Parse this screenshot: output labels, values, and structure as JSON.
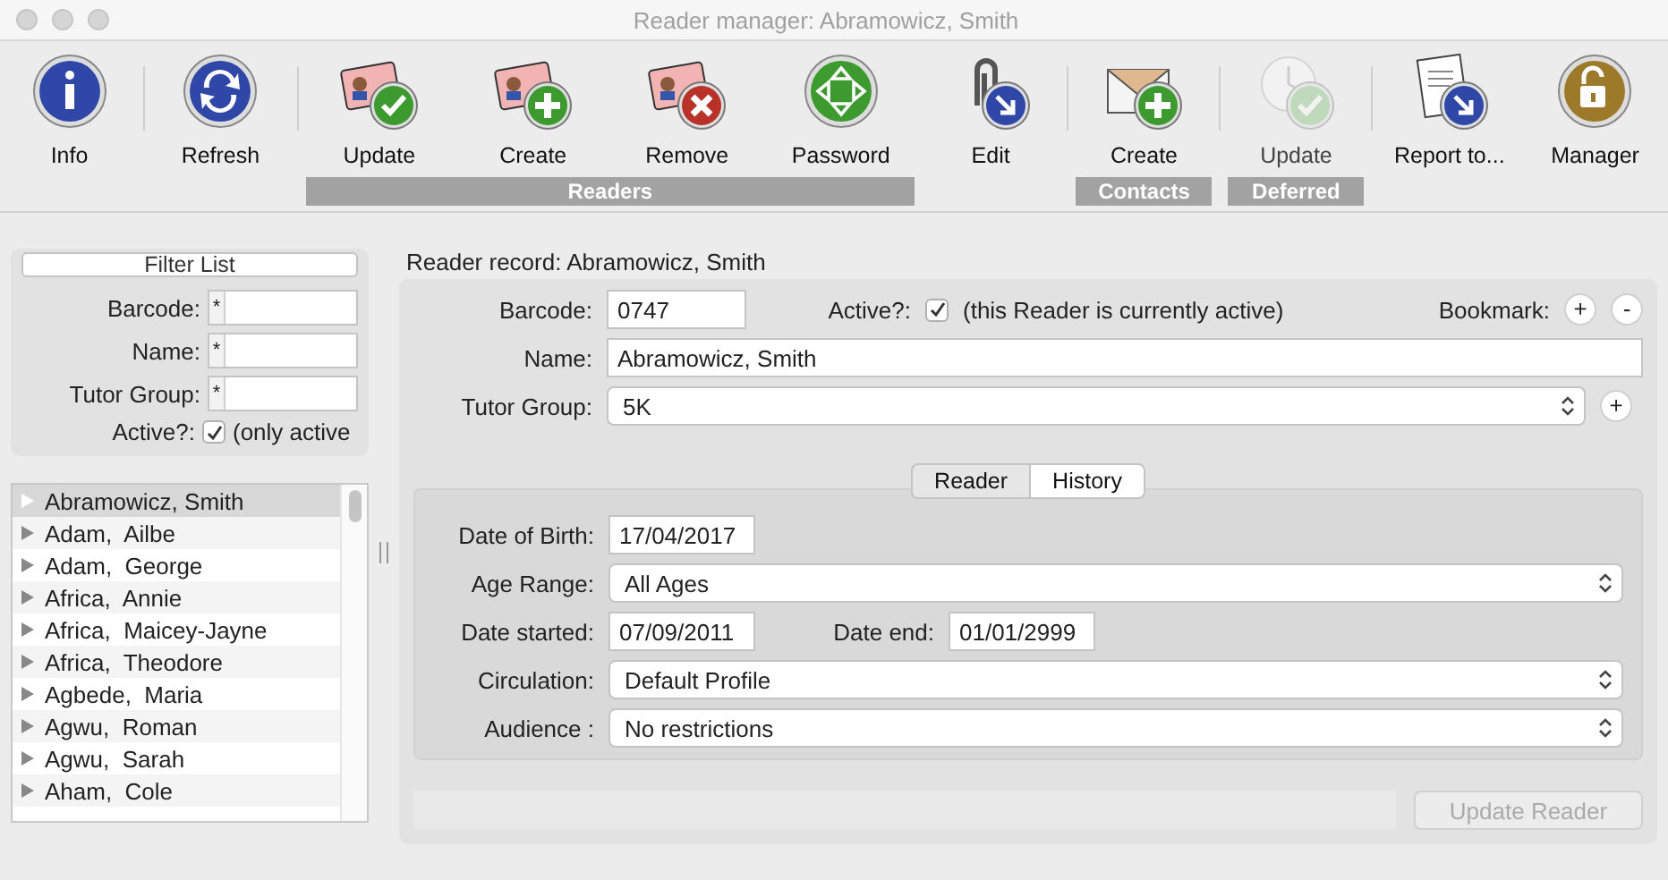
{
  "window": {
    "title": "Reader manager: Abramowicz, Smith"
  },
  "toolbar": [
    {
      "kind": "item",
      "label": "Info",
      "disabled": false
    },
    {
      "kind": "separator"
    },
    {
      "kind": "item",
      "label": "Refresh",
      "disabled": false
    },
    {
      "kind": "separator"
    },
    {
      "kind": "group",
      "label": "Readers",
      "items": [
        {
          "label": "Update",
          "disabled": false
        },
        {
          "label": "Create",
          "disabled": false
        },
        {
          "label": "Remove",
          "disabled": false
        },
        {
          "label": "Password",
          "disabled": false
        }
      ]
    },
    {
      "kind": "item",
      "label": "Edit",
      "disabled": false
    },
    {
      "kind": "separator"
    },
    {
      "kind": "group",
      "label": "Contacts",
      "items": [
        {
          "label": "Create",
          "disabled": false
        }
      ]
    },
    {
      "kind": "separator"
    },
    {
      "kind": "group",
      "label": "Deferred",
      "items": [
        {
          "label": "Update",
          "disabled": true
        }
      ]
    },
    {
      "kind": "separator"
    },
    {
      "kind": "item",
      "label": "Report to...",
      "disabled": false
    },
    {
      "kind": "item",
      "label": "Manager",
      "disabled": false
    }
  ],
  "filter": {
    "button": "Filter List",
    "fields": [
      {
        "label": "Barcode:",
        "prefix": "*"
      },
      {
        "label": "Name:",
        "prefix": "*"
      },
      {
        "label": "Tutor Group:",
        "prefix": "*"
      }
    ],
    "active": {
      "label": "Active?:",
      "checked": true,
      "text": "(only active"
    }
  },
  "readers": [
    {
      "name": "Abramowicz, Smith",
      "selected": true
    },
    {
      "name": "Adam,  Ailbe",
      "selected": false
    },
    {
      "name": "Adam,  George",
      "selected": false
    },
    {
      "name": "Africa,  Annie",
      "selected": false
    },
    {
      "name": "Africa,  Maicey-Jayne",
      "selected": false
    },
    {
      "name": "Africa,  Theodore",
      "selected": false
    },
    {
      "name": "Agbede,  Maria",
      "selected": false
    },
    {
      "name": "Agwu,  Roman",
      "selected": false
    },
    {
      "name": "Agwu,  Sarah",
      "selected": false
    },
    {
      "name": "Aham,  Cole",
      "selected": false
    }
  ],
  "record": {
    "title": "Reader record: Abramowicz, Smith",
    "barcode": {
      "label": "Barcode:",
      "value": "0747"
    },
    "active": {
      "label": "Active?:",
      "checked": true,
      "text": "(this Reader is currently active)"
    },
    "bookmark": {
      "label": "Bookmark:",
      "add": "+",
      "remove": "-"
    },
    "name": {
      "label": "Name:",
      "value": "Abramowicz, Smith"
    },
    "tutor_group": {
      "label": "Tutor Group:",
      "value": "5K",
      "add": "+"
    },
    "tabs": [
      {
        "label": "Reader",
        "selected": true
      },
      {
        "label": "History",
        "selected": false
      }
    ],
    "date_of_birth": {
      "label": "Date of Birth:",
      "value": "17/04/2017"
    },
    "age_range": {
      "label": "Age Range:",
      "value": "All Ages"
    },
    "date_started": {
      "label": "Date started:",
      "value": "07/09/2011"
    },
    "date_end": {
      "label": "Date end:",
      "value": "01/01/2999"
    },
    "circulation": {
      "label": "Circulation:",
      "value": "Default Profile"
    },
    "audience": {
      "label": "Audience :",
      "value": "No restrictions"
    },
    "update_button": {
      "label": "Update Reader",
      "disabled": true
    }
  }
}
